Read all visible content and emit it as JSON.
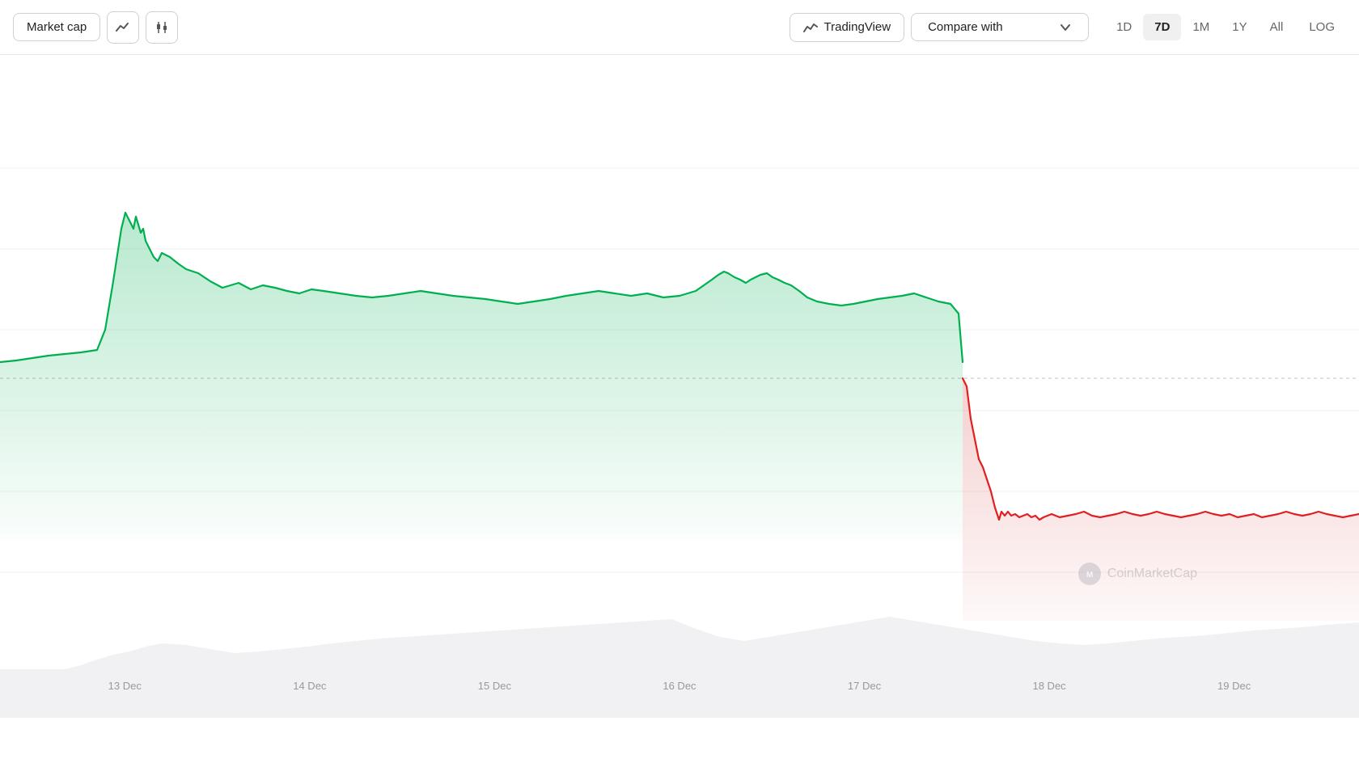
{
  "toolbar": {
    "market_cap_label": "Market cap",
    "tradingview_label": "TradingView",
    "compare_with_label": "Compare with",
    "periods": [
      {
        "label": "1D",
        "active": false
      },
      {
        "label": "7D",
        "active": true
      },
      {
        "label": "1M",
        "active": false
      },
      {
        "label": "1Y",
        "active": false
      },
      {
        "label": "All",
        "active": false
      }
    ],
    "log_label": "LOG"
  },
  "chart": {
    "x_labels": [
      "13 Dec",
      "14 Dec",
      "15 Dec",
      "16 Dec",
      "17 Dec",
      "18 Dec",
      "19 Dec"
    ],
    "watermark_text": "CoinMarketCap"
  },
  "colors": {
    "green_line": "#00b050",
    "green_fill_top": "rgba(0,176,80,0.25)",
    "green_fill_bottom": "rgba(0,176,80,0.0)",
    "red_line": "#e03030",
    "red_fill_top": "rgba(220,50,50,0.25)",
    "red_fill_bottom": "rgba(220,50,50,0.05)",
    "baseline": "rgba(0,0,0,0.15)"
  }
}
